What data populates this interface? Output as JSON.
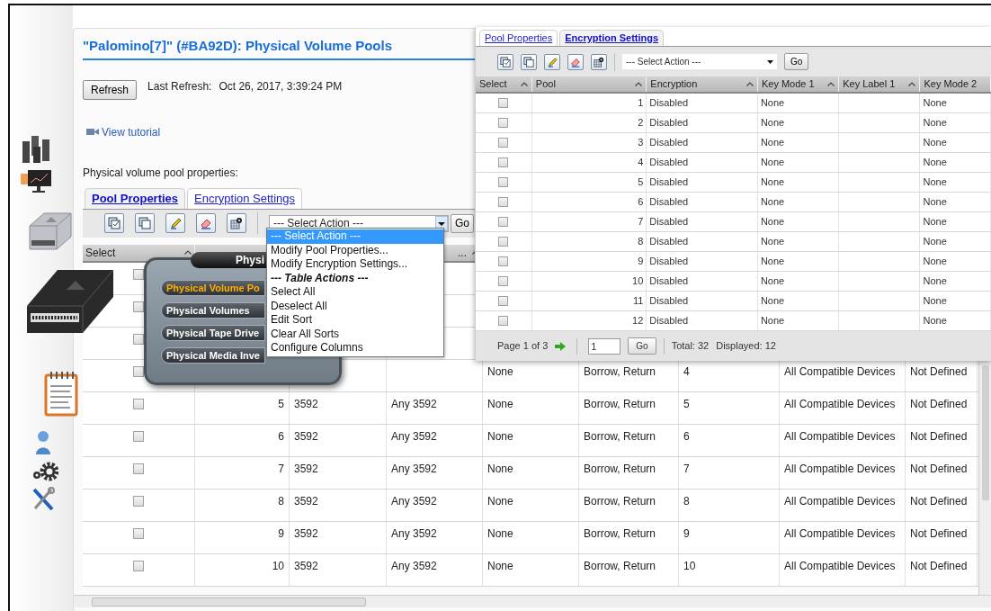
{
  "page": {
    "title": "\"Palomino[7]\" (#BA92D): Physical Volume Pools",
    "refresh_button": "Refresh",
    "last_refresh_label": "Last Refresh:",
    "last_refresh_value": "Oct 26, 2017, 3:39:24 PM",
    "tutorial_link": "View tutorial",
    "section_label": "Physical volume pool properties:"
  },
  "tabs": [
    {
      "label": "Pool Properties",
      "selected": true
    },
    {
      "label": "Encryption Settings",
      "selected": false
    }
  ],
  "toolbar": {
    "action_select": "--- Select Action ---",
    "go_button": "Go"
  },
  "table": {
    "headers": {
      "select": "Select",
      "column_4": "..."
    },
    "rows": [
      {
        "checked": false
      },
      {
        "checked": false
      },
      {
        "checked": false
      },
      {
        "checked": false,
        "column_5": "None",
        "column_6": "Borrow, Return",
        "column_7": "4",
        "column_8": "All Compatible Devices",
        "column_9": "Not Defined"
      },
      {
        "checked": false,
        "pool": "5",
        "column_3": "3592",
        "column_4": "Any 3592",
        "column_5": "None",
        "column_6": "Borrow, Return",
        "column_7": "5",
        "column_8": "All Compatible Devices",
        "column_9": "Not Defined"
      },
      {
        "checked": false,
        "pool": "6",
        "column_3": "3592",
        "column_4": "Any 3592",
        "column_5": "None",
        "column_6": "Borrow, Return",
        "column_7": "6",
        "column_8": "All Compatible Devices",
        "column_9": "Not Defined"
      },
      {
        "checked": false,
        "pool": "7",
        "column_3": "3592",
        "column_4": "Any 3592",
        "column_5": "None",
        "column_6": "Borrow, Return",
        "column_7": "7",
        "column_8": "All Compatible Devices",
        "column_9": "Not Defined"
      },
      {
        "checked": false,
        "pool": "8",
        "column_3": "3592",
        "column_4": "Any 3592",
        "column_5": "None",
        "column_6": "Borrow, Return",
        "column_7": "8",
        "column_8": "All Compatible Devices",
        "column_9": "Not Defined"
      },
      {
        "checked": false,
        "pool": "9",
        "column_3": "3592",
        "column_4": "Any 3592",
        "column_5": "None",
        "column_6": "Borrow, Return",
        "column_7": "9",
        "column_8": "All Compatible Devices",
        "column_9": "Not Defined"
      },
      {
        "checked": false,
        "pool": "10",
        "column_3": "3592",
        "column_4": "Any 3592",
        "column_5": "None",
        "column_6": "Borrow, Return",
        "column_7": "10",
        "column_8": "All Compatible Devices",
        "column_9": "Not Defined"
      }
    ]
  },
  "action_menu": [
    {
      "text": "--- Select Action ---",
      "kind": "option",
      "selected": true
    },
    {
      "text": "Modify Pool Properties...",
      "kind": "option",
      "selected": false
    },
    {
      "text": "Modify Encryption Settings...",
      "kind": "option",
      "selected": false
    },
    {
      "text": "--- Table Actions ---",
      "kind": "heading",
      "selected": false
    },
    {
      "text": "Select All",
      "kind": "option",
      "selected": false
    },
    {
      "text": "Deselect All",
      "kind": "option",
      "selected": false
    },
    {
      "text": "Edit Sort",
      "kind": "option",
      "selected": false
    },
    {
      "text": "Clear All Sorts",
      "kind": "option",
      "selected": false
    },
    {
      "text": "Configure Columns",
      "kind": "option",
      "selected": false
    }
  ],
  "nav_bubble": {
    "title": "Physi",
    "items": [
      {
        "label": "Physical Volume Po",
        "selected": true
      },
      {
        "label": "Physical Volumes",
        "selected": false
      },
      {
        "label": "Physical Tape Drive",
        "selected": false
      },
      {
        "label": "Physical Media Inve",
        "selected": false
      }
    ]
  },
  "encryption_window": {
    "tabs": [
      {
        "label": "Pool Properties",
        "selected": false
      },
      {
        "label": "Encryption Settings",
        "selected": true
      }
    ],
    "action_select": "--- Select Action ---",
    "go_button": "Go",
    "columns": [
      "Select",
      "Pool",
      "Encryption",
      "Key Mode 1",
      "Key Label 1",
      "Key Mode 2"
    ],
    "rows": [
      {
        "checked": false,
        "pool": "1",
        "encryption": "Disabled",
        "key_mode_1": "None",
        "key_mode_2": "None"
      },
      {
        "checked": false,
        "pool": "2",
        "encryption": "Disabled",
        "key_mode_1": "None",
        "key_mode_2": "None"
      },
      {
        "checked": false,
        "pool": "3",
        "encryption": "Disabled",
        "key_mode_1": "None",
        "key_mode_2": "None"
      },
      {
        "checked": false,
        "pool": "4",
        "encryption": "Disabled",
        "key_mode_1": "None",
        "key_mode_2": "None"
      },
      {
        "checked": false,
        "pool": "5",
        "encryption": "Disabled",
        "key_mode_1": "None",
        "key_mode_2": "None"
      },
      {
        "checked": false,
        "pool": "6",
        "encryption": "Disabled",
        "key_mode_1": "None",
        "key_mode_2": "None"
      },
      {
        "checked": false,
        "pool": "7",
        "encryption": "Disabled",
        "key_mode_1": "None",
        "key_mode_2": "None"
      },
      {
        "checked": false,
        "pool": "8",
        "encryption": "Disabled",
        "key_mode_1": "None",
        "key_mode_2": "None"
      },
      {
        "checked": false,
        "pool": "9",
        "encryption": "Disabled",
        "key_mode_1": "None",
        "key_mode_2": "None"
      },
      {
        "checked": false,
        "pool": "10",
        "encryption": "Disabled",
        "key_mode_1": "None",
        "key_mode_2": "None"
      },
      {
        "checked": false,
        "pool": "11",
        "encryption": "Disabled",
        "key_mode_1": "None",
        "key_mode_2": "None"
      },
      {
        "checked": false,
        "pool": "12",
        "encryption": "Disabled",
        "key_mode_1": "None",
        "key_mode_2": "None"
      }
    ],
    "footer": {
      "page_label": "Page 1 of 3",
      "page_input": "1",
      "go_button": "Go",
      "total": "Total: 32",
      "displayed": "Displayed: 12"
    }
  }
}
